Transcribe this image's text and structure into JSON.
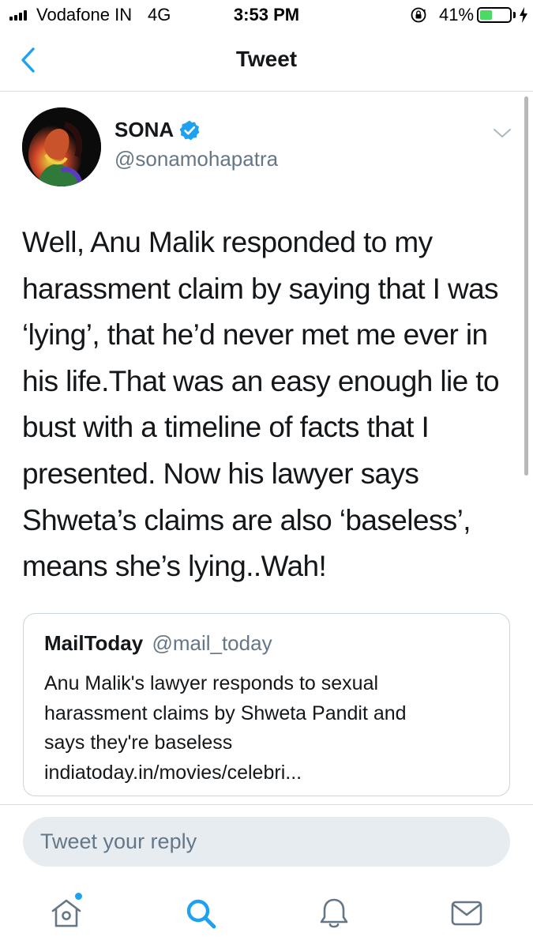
{
  "status_bar": {
    "carrier": "Vodafone IN",
    "network": "4G",
    "time": "3:53 PM",
    "battery_percent": "41%",
    "battery_level": 0.41,
    "icons": [
      "signal-icon",
      "rotation-lock-icon",
      "battery-icon",
      "charging-icon"
    ]
  },
  "header": {
    "title": "Tweet",
    "back_icon": "chevron-left-icon"
  },
  "tweet": {
    "author_name": "SONA",
    "author_handle": "@sonamohapatra",
    "verified": true,
    "text": "Well, Anu Malik responded to my harassment claim by saying that I was ‘lying’, that he’d never met me ever in his life.That was an easy enough lie to bust with a timeline of facts that I presented. Now his lawyer says Shweta’s claims are also ‘baseless’, means she’s lying..Wah!",
    "quoted": {
      "name": "MailToday",
      "handle": "@mail_today",
      "lines": [
        "Anu Malik's lawyer responds to sexual",
        "harassment claims by Shweta Pandit and",
        "says they're baseless",
        "indiatoday.in/movies/celebri..."
      ]
    }
  },
  "reply": {
    "placeholder": "Tweet your reply"
  },
  "tab_bar": {
    "items": [
      "home-icon",
      "search-icon",
      "notifications-icon",
      "messages-icon"
    ],
    "active": "search-icon"
  },
  "colors": {
    "accent": "#1da1f2",
    "text": "#14171a",
    "secondary": "#657786",
    "border": "#ccd6dd",
    "reply_bg": "#e6ecf0",
    "battery": "#4cd964"
  }
}
